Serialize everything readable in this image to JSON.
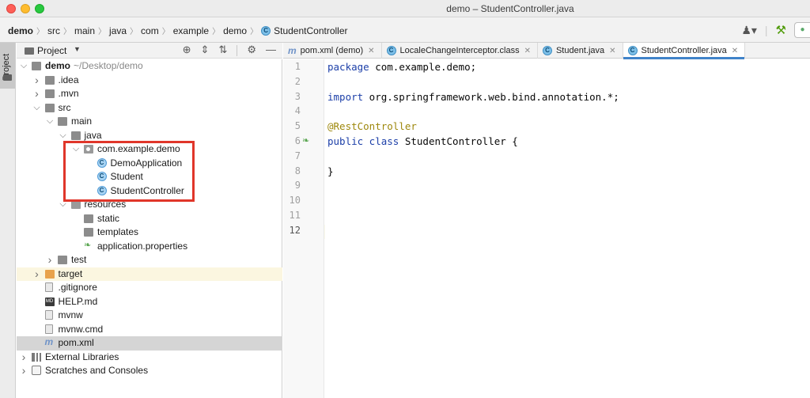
{
  "window": {
    "title": "demo – StudentController.java"
  },
  "breadcrumb": [
    "demo",
    "src",
    "main",
    "java",
    "com",
    "example",
    "demo",
    "StudentController"
  ],
  "project_panel": {
    "title": "Project",
    "strip_label": "Project"
  },
  "tree": [
    {
      "label": "demo",
      "extra": "~/Desktop/demo",
      "icon": "folder-icon",
      "indent": 0,
      "arrow": "down"
    },
    {
      "label": ".idea",
      "icon": "folder-icon",
      "indent": 1,
      "arrow": "right"
    },
    {
      "label": ".mvn",
      "icon": "folder-icon",
      "indent": 1,
      "arrow": "right"
    },
    {
      "label": "src",
      "icon": "folder-icon",
      "indent": 1,
      "arrow": "down"
    },
    {
      "label": "main",
      "icon": "folder-icon",
      "indent": 2,
      "arrow": "down"
    },
    {
      "label": "java",
      "icon": "folder-icon",
      "indent": 3,
      "arrow": "down"
    },
    {
      "label": "com.example.demo",
      "icon": "package-icon",
      "indent": 4,
      "arrow": "down"
    },
    {
      "label": "DemoApplication",
      "icon": "spring-class-icon",
      "indent": 5,
      "arrow": ""
    },
    {
      "label": "Student",
      "icon": "class-icon",
      "indent": 5,
      "arrow": ""
    },
    {
      "label": "StudentController",
      "icon": "class-icon",
      "indent": 5,
      "arrow": ""
    },
    {
      "label": "resources",
      "icon": "resources-folder-icon",
      "indent": 3,
      "arrow": "down"
    },
    {
      "label": "static",
      "icon": "folder-icon",
      "indent": 4,
      "arrow": ""
    },
    {
      "label": "templates",
      "icon": "folder-icon",
      "indent": 4,
      "arrow": ""
    },
    {
      "label": "application.properties",
      "icon": "properties-icon",
      "indent": 4,
      "arrow": ""
    },
    {
      "label": "test",
      "icon": "folder-icon",
      "indent": 2,
      "arrow": "right"
    },
    {
      "label": "target",
      "icon": "excluded-folder-icon",
      "indent": 1,
      "arrow": "right"
    },
    {
      "label": ".gitignore",
      "icon": "file-icon",
      "indent": 1,
      "arrow": ""
    },
    {
      "label": "HELP.md",
      "icon": "markdown-icon",
      "indent": 1,
      "arrow": ""
    },
    {
      "label": "mvnw",
      "icon": "script-icon",
      "indent": 1,
      "arrow": ""
    },
    {
      "label": "mvnw.cmd",
      "icon": "file-icon",
      "indent": 1,
      "arrow": ""
    },
    {
      "label": "pom.xml",
      "icon": "maven-icon",
      "indent": 1,
      "arrow": ""
    },
    {
      "label": "External Libraries",
      "icon": "library-icon",
      "indent": 0,
      "arrow": "right"
    },
    {
      "label": "Scratches and Consoles",
      "icon": "scratch-icon",
      "indent": 0,
      "arrow": "right"
    }
  ],
  "tabs": [
    {
      "label": "pom.xml (demo)",
      "icon": "maven-icon",
      "active": false
    },
    {
      "label": "LocaleChangeInterceptor.class",
      "icon": "class-icon",
      "active": false
    },
    {
      "label": "Student.java",
      "icon": "class-icon",
      "active": false
    },
    {
      "label": "StudentController.java",
      "icon": "class-icon",
      "active": true
    }
  ],
  "editor": {
    "current_line": 12,
    "lines": [
      {
        "n": "1",
        "tokens": [
          [
            "kw",
            "package"
          ],
          [
            "",
            " com.example.demo;"
          ]
        ]
      },
      {
        "n": "2",
        "tokens": []
      },
      {
        "n": "3",
        "tokens": [
          [
            "kw",
            "import"
          ],
          [
            "",
            " org.springframework.web.bind.annotation.*;"
          ]
        ]
      },
      {
        "n": "4",
        "tokens": []
      },
      {
        "n": "5",
        "tokens": [
          [
            "ann",
            "@RestController"
          ]
        ]
      },
      {
        "n": "6",
        "tokens": [
          [
            "kw",
            "public class"
          ],
          [
            "",
            " StudentController {"
          ]
        ]
      },
      {
        "n": "7",
        "tokens": []
      },
      {
        "n": "8",
        "tokens": [
          [
            "",
            "}"
          ]
        ]
      },
      {
        "n": "9",
        "tokens": []
      },
      {
        "n": "10",
        "tokens": []
      },
      {
        "n": "11",
        "tokens": []
      },
      {
        "n": "12",
        "tokens": []
      }
    ]
  },
  "colors": {
    "accent": "#4083c9",
    "highlight_box": "#e0362a",
    "keyword": "#1c3fa8",
    "annotation": "#9e880d"
  }
}
